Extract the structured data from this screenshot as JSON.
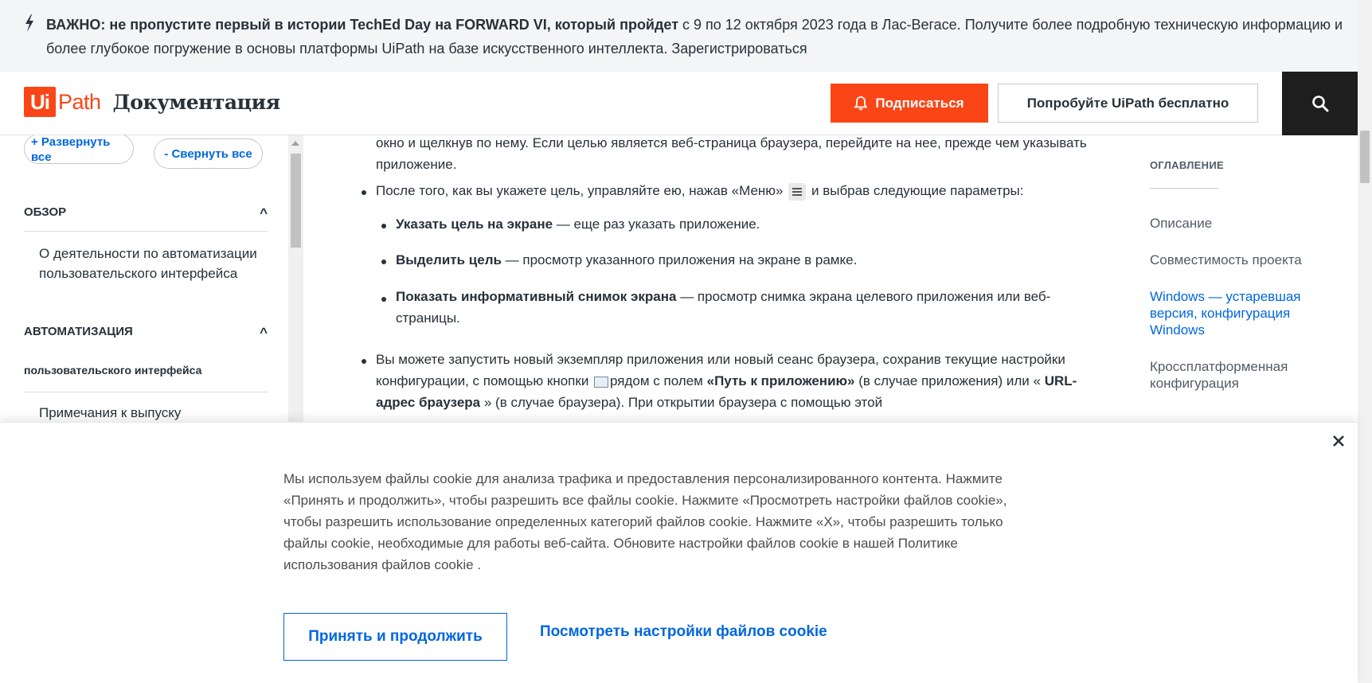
{
  "banner": {
    "bold_text": "ВАЖНО: не пропустите первый в истории TechEd Day на FORWARD VI, который пройдет",
    "text": " с 9 по 12 октября 2023 года в Лас-Вегасе. Получите более подробную техническую информацию и более глубокое погружение в основы платформы UiPath на базе искусственного интеллекта. Зарегистрироваться"
  },
  "header": {
    "logo_ui": "Ui",
    "logo_path": "Path",
    "docs_title": "Документация",
    "subscribe_label": "Подписаться",
    "try_label": "Попробуйте UiPath бесплатно"
  },
  "sidebar": {
    "expand_label": "+ Развернуть все",
    "collapse_label": "- Свернуть все",
    "section_overview": "ОБЗОР",
    "overview_item": "О деятельности по автоматизации пользовательского интерфейса",
    "section_automation": "АВТОМАТИЗАЦИЯ",
    "automation_sub": "пользовательского интерфейса",
    "release_notes": "Примечания к выпуску",
    "caret": "^"
  },
  "content": {
    "intro": "окно и щелкнув по нему. Если целью является веб-страница браузера, перейдите на нее, прежде чем указывать приложение.",
    "bullet1_a": "После того, как вы укажете цель, управляйте ею, нажав «Меню»",
    "bullet1_b": "и выбрав следующие параметры:",
    "opt1_bold": "Указать цель на экране",
    "opt1_text": " — еще раз указать приложение.",
    "opt2_bold": "Выделить цель",
    "opt2_text": " — просмотр указанного приложения на экране в рамке.",
    "opt3_bold": "Показать информативный снимок экрана",
    "opt3_text": " — просмотр снимка экрана целевого приложения или веб-страницы.",
    "bullet2_a": "Вы можете запустить новый экземпляр приложения или новый сеанс браузера, сохранив текущие настройки конфигурации, с помощью кнопки",
    "bullet2_b": "рядом с полем ",
    "bullet2_bold1": "«Путь к приложению»",
    "bullet2_c": " (в случае приложения) или « ",
    "bullet2_bold2": "URL-адрес браузера",
    "bullet2_d": " » (в случае браузера). При открытии браузера с помощью этой"
  },
  "toc": {
    "title": "ОГЛАВЛЕНИЕ",
    "items": [
      "Описание",
      "Совместимость проекта",
      "Windows — устаревшая версия, конфигурация Windows",
      "Кроссплатформенная конфигурация"
    ]
  },
  "cookie": {
    "text": "Мы используем файлы cookie для анализа трафика и предоставления персонализированного контента. Нажмите «Принять и продолжить», чтобы разрешить все файлы cookie. Нажмите «Просмотреть настройки файлов cookie», чтобы разрешить использование определенных категорий файлов cookie. Нажмите «X», чтобы разрешить только файлы cookie, необходимые для работы веб-сайта. Обновите настройки файлов cookie в нашей Политике использования файлов cookie .",
    "accept_label": "Принять и продолжить",
    "settings_label": "Посмотреть настройки файлов cookie"
  },
  "colors": {
    "brand": "#fa4616",
    "link": "#0067df",
    "dark": "#1e1e1e"
  }
}
